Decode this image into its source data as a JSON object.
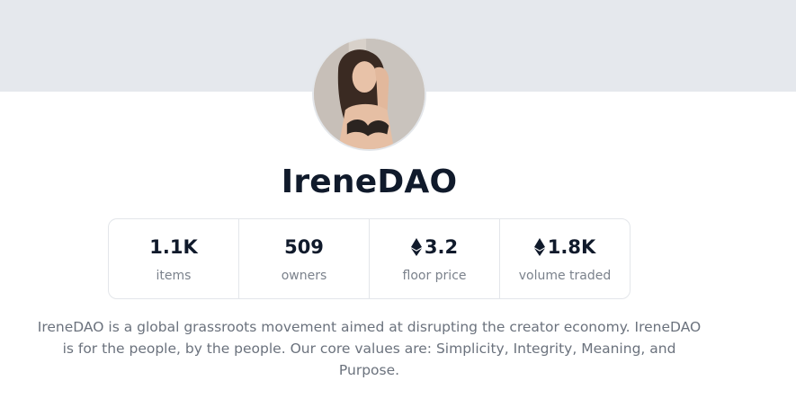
{
  "collection": {
    "name": "IreneDAO",
    "description": "IreneDAO is a global grassroots movement aimed at disrupting the creator economy. IreneDAO is for the people, by the people. Our core values are: Simplicity, Integrity, Meaning, and Purpose."
  },
  "stats": [
    {
      "value": "1.1K",
      "label": "items",
      "icon": null
    },
    {
      "value": "509",
      "label": "owners",
      "icon": null
    },
    {
      "value": "3.2",
      "label": "floor price",
      "icon": "ethereum-icon"
    },
    {
      "value": "1.8K",
      "label": "volume traded",
      "icon": "ethereum-icon"
    }
  ],
  "colors": {
    "banner": "#e5e8ed",
    "title": "#101a2b",
    "muted_text": "#7b828c",
    "border": "#e3e6ea"
  }
}
